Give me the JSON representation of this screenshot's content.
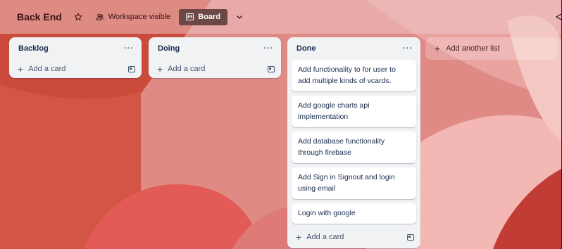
{
  "board": {
    "title": "Back End",
    "visibility_label": "Workspace visible",
    "view_label": "Board"
  },
  "lists": [
    {
      "title": "Backlog",
      "menu": "···",
      "add_card_label": "Add a card",
      "cards": []
    },
    {
      "title": "Doing",
      "menu": "···",
      "add_card_label": "Add a card",
      "cards": []
    },
    {
      "title": "Done",
      "menu": "···",
      "add_card_label": "Add a card",
      "cards": [
        "Add functionality to for user to add multiple kinds of vcards.",
        "Add google charts api implementation",
        "Add database functionality through firebase",
        "Add Sign in Signout and login using email",
        "Login with google"
      ]
    }
  ],
  "add_list_label": "Add another list",
  "colors": {
    "accent": "#6b4746",
    "list_bg": "#f1f2f4",
    "text": "#172b4d"
  },
  "icons": [
    "star-icon",
    "workspace-icon",
    "board-icon",
    "chevron-down-icon",
    "plus-icon",
    "card-template-icon",
    "filter-icon"
  ]
}
